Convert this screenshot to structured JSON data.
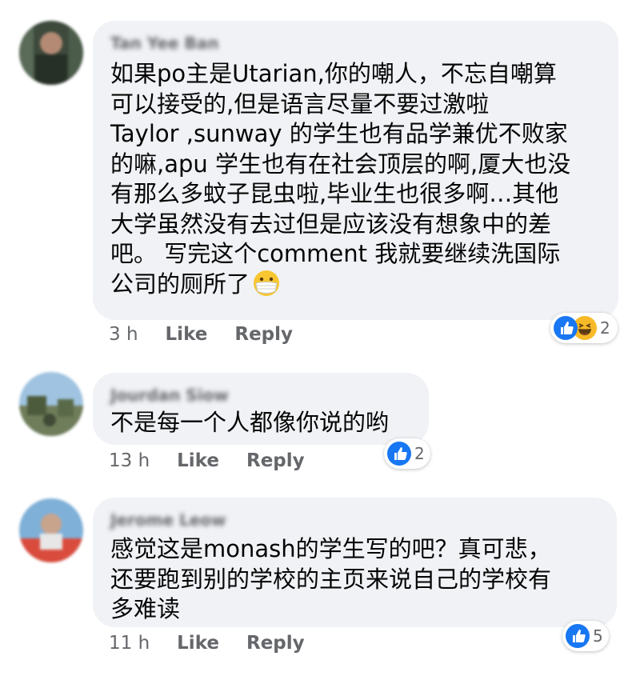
{
  "comments": [
    {
      "author": "Tan Yee Ban",
      "text": "如果po主是Utarian,你的嘲人，不忘自嘲算\n可以接受的,但是语言尽量不要过激啦\nTaylor ,sunway 的学生也有品学兼优不败家\n的嘛,apu 学生也有在社会顶层的啊,厦大也没\n有那么多蚊子昆虫啦,毕业生也很多啊…其他\n大学虽然没有去过但是应该没有想象中的差\n吧。 写完这个comment 我就要继续洗国际\n公司的厕所了",
      "time": "3 h",
      "like_label": "Like",
      "reply_label": "Reply",
      "reaction_icons": [
        "like-icon",
        "haha-icon"
      ],
      "reaction_count": "2"
    },
    {
      "author": "Jourdan Siow",
      "text": "不是每一个人都像你说的哟",
      "time": "13 h",
      "like_label": "Like",
      "reply_label": "Reply",
      "reaction_icons": [
        "like-icon"
      ],
      "reaction_count": "2"
    },
    {
      "author": "Jerome Leow",
      "text": "感觉这是monash的学生写的吧？真可悲，\n还要跑到别的学校的主页来说自己的学校有\n多难读",
      "time": "11 h",
      "like_label": "Like",
      "reply_label": "Reply",
      "reaction_icons": [
        "like-icon"
      ],
      "reaction_count": "5"
    }
  ],
  "colors": {
    "bubble": "#f0f2f5",
    "meta_text": "#65676b",
    "body_text": "#050505",
    "like_blue": "#1877f2",
    "haha_yellow": "#f7b928"
  }
}
